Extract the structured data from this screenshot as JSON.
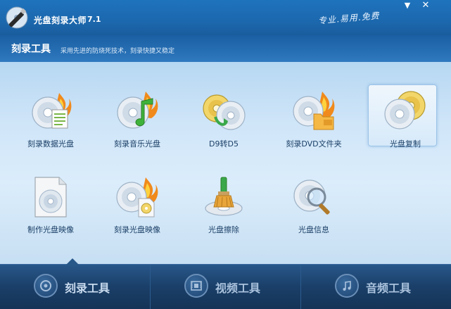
{
  "window": {
    "title": "光盘刻录大师",
    "version": "7.1",
    "slogan": "专业.易用.免费",
    "minimize_glyph": "▼",
    "close_glyph": "✕"
  },
  "section": {
    "title": "刻录工具",
    "subtitle": "采用先进的防烧死技术，刻录快捷又稳定"
  },
  "tools": [
    {
      "label": "刻录数据光盘",
      "icon": "burn-data-disc-icon"
    },
    {
      "label": "刻录音乐光盘",
      "icon": "burn-music-disc-icon"
    },
    {
      "label": "D9转D5",
      "icon": "d9-to-d5-icon"
    },
    {
      "label": "刻录DVD文件夹",
      "icon": "burn-dvd-folder-icon"
    },
    {
      "label": "光盘复制",
      "icon": "disc-copy-icon",
      "selected": true
    },
    {
      "label": "制作光盘映像",
      "icon": "make-disc-image-icon"
    },
    {
      "label": "刻录光盘映像",
      "icon": "burn-disc-image-icon"
    },
    {
      "label": "光盘擦除",
      "icon": "disc-erase-icon"
    },
    {
      "label": "光盘信息",
      "icon": "disc-info-icon"
    }
  ],
  "bottom_nav": [
    {
      "label": "刻录工具",
      "icon": "disc-icon",
      "active": true
    },
    {
      "label": "视频工具",
      "icon": "film-icon"
    },
    {
      "label": "音频工具",
      "icon": "music-note-icon"
    }
  ],
  "colors": {
    "titlebar": "#1c68ae",
    "content_bg": "#cfe5f8",
    "nav_bg": "#1a3f68",
    "label_text": "#1b3f66"
  }
}
